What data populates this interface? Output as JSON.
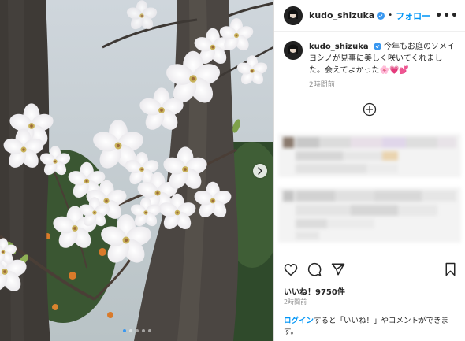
{
  "post": {
    "username": "kudo_shizuka",
    "follow_label": "フォロー",
    "header_separator": "•",
    "more_label": "•••",
    "caption": "今年もお庭のソメイヨシノが見事に美しく咲いてくれました。会えてよかった🌸💗💕",
    "caption_time": "2時間前",
    "likes": "いいね！9750件",
    "post_time": "2時間前",
    "login_link": "ログイン",
    "login_rest": "すると「いいね！」やコメントができます。"
  },
  "carousel": {
    "slide_count": 5,
    "active_index": 0
  },
  "icons": {
    "verified": "verified-badge-icon",
    "load_more": "plus-circle-icon",
    "like": "heart-icon",
    "comment": "comment-icon",
    "share": "paper-plane-icon",
    "save": "bookmark-icon",
    "next": "chevron-right-icon"
  },
  "colors": {
    "accent": "#0095f6",
    "verified": "#3897f0",
    "muted": "#8e8e8e"
  }
}
